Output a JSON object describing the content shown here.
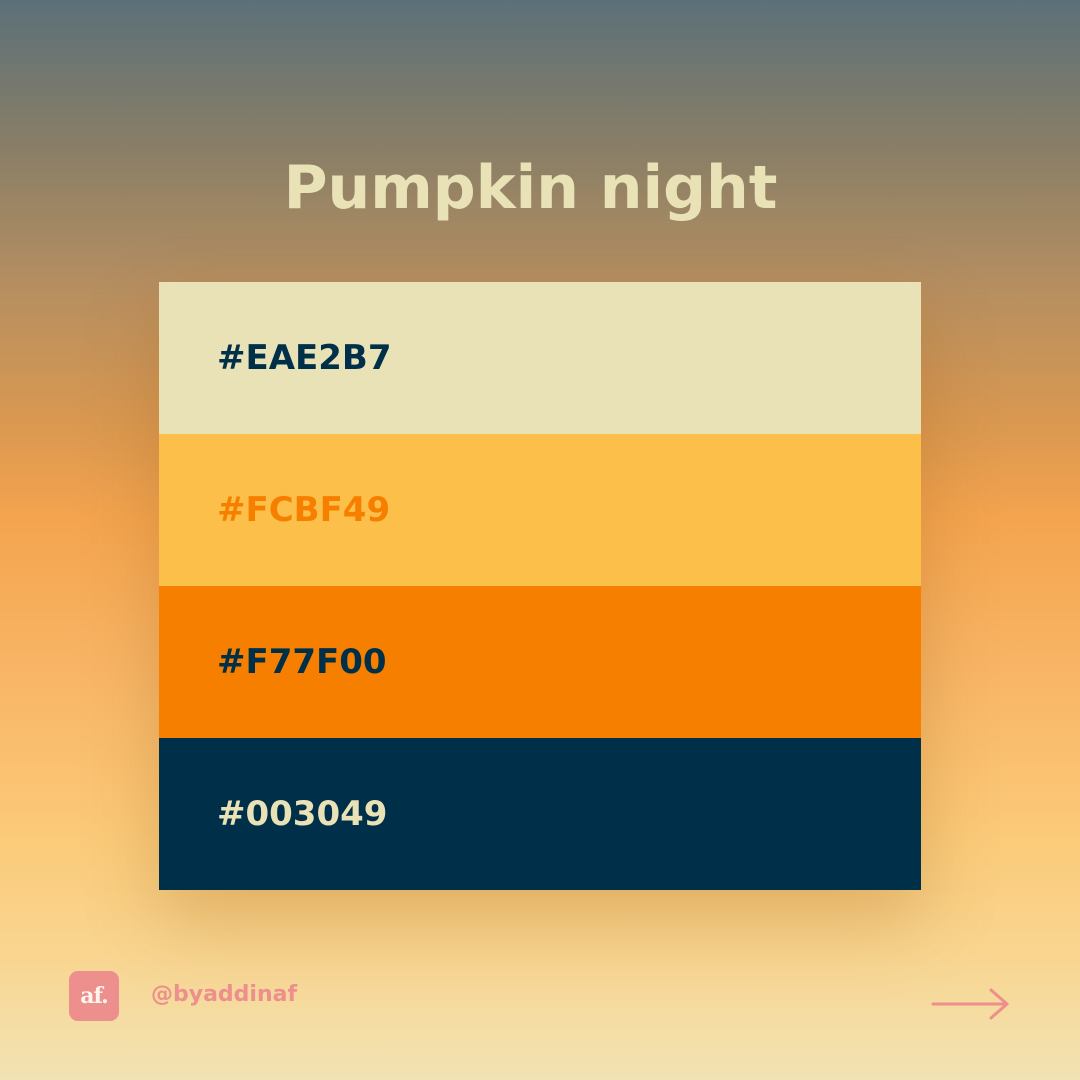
{
  "title": "Pumpkin night",
  "swatches": [
    {
      "hex": "#EAE2B7",
      "background": "#EAE2B7",
      "text_color": "#003049"
    },
    {
      "hex": "#FCBF49",
      "background": "#FCBF49",
      "text_color": "#F77F00"
    },
    {
      "hex": "#F77F00",
      "background": "#F77F00",
      "text_color": "#003049"
    },
    {
      "hex": "#003049",
      "background": "#003049",
      "text_color": "#EAE2B7"
    }
  ],
  "footer": {
    "logo_text": "af.",
    "handle": "@byaddinaf",
    "accent_color": "#EC8F8D",
    "next_icon": "arrow-right-icon"
  }
}
